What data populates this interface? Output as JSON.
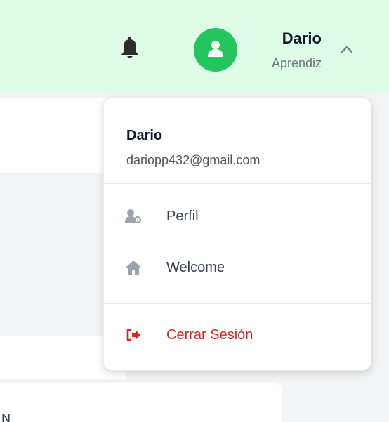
{
  "header": {
    "user_name": "Dario",
    "user_role": "Aprendiz"
  },
  "icons": {
    "notifications": "bell-icon",
    "avatar": "user-icon",
    "toggle": "chevron-up-icon"
  },
  "colors": {
    "header_bg": "#dcfce7",
    "avatar_bg": "#22c55e",
    "danger": "#dc2626"
  },
  "dropdown": {
    "name": "Dario",
    "email": "dariopp432@gmail.com",
    "items": [
      {
        "label": "Perfil",
        "icon": "user-settings-icon"
      },
      {
        "label": "Welcome",
        "icon": "home-icon"
      }
    ],
    "logout": {
      "label": "Cerrar Sesión",
      "icon": "sign-out-icon"
    }
  },
  "background": {
    "partial_text": "N"
  }
}
